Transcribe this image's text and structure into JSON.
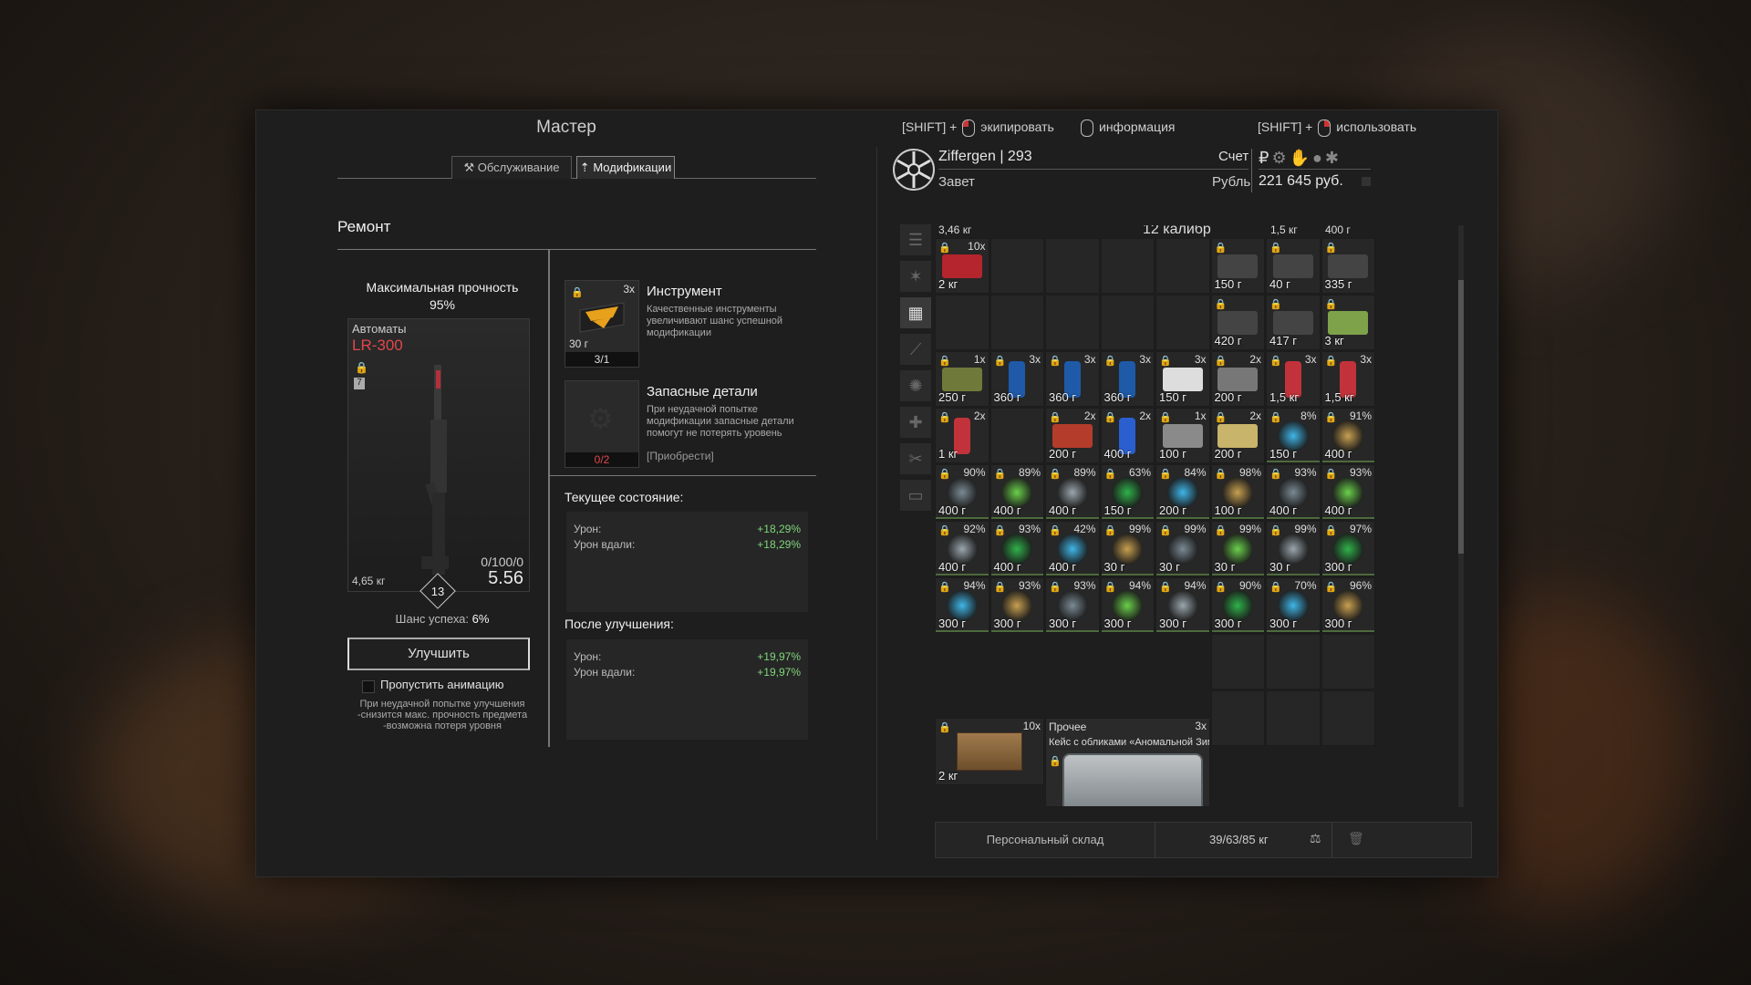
{
  "master": {
    "title": "Мастер",
    "tabs": [
      {
        "label": "Обслуживание",
        "icon": "wrench-icon"
      },
      {
        "label": "Модификации",
        "icon": "upgrade-icon"
      }
    ],
    "section_title": "Ремонт",
    "durability_label": "Максимальная прочность",
    "durability_value": "95%",
    "weapon": {
      "category": "Автоматы",
      "name": "LR-300",
      "rank_badge": "7",
      "weight": "4,65 кг",
      "level": "13",
      "ammo_counter": "0/100/0",
      "caliber": "5.56"
    },
    "success_chance_label": "Шанс успеха:",
    "success_chance_value": "6%",
    "upgrade_button": "Улучшить",
    "skip_animation": "Пропустить анимацию",
    "failure_note": [
      "При неудачной попытке улучшения",
      "-снизится макс. прочность предмета",
      "-возможна потеря уровня"
    ],
    "tool": {
      "title": "Инструмент",
      "count": "3x",
      "weight": "30 г",
      "usage": "3/1",
      "desc": [
        "Качественные инструменты",
        "увеличивают шанс успешной",
        "модификации"
      ]
    },
    "spare": {
      "title": "Запасные детали",
      "usage": "0/2",
      "desc": [
        "При неудачной попытке",
        "модификации запасные детали",
        "помогут не потерять уровень"
      ],
      "buy": "[Приобрести]"
    },
    "current_state": {
      "title": "Текущее состояние:",
      "rows": [
        {
          "label": "Урон:",
          "value": "+18,29%"
        },
        {
          "label": "Урон вдали:",
          "value": "+18,29%"
        }
      ]
    },
    "after_upgrade": {
      "title": "После улучшения:",
      "rows": [
        {
          "label": "Урон:",
          "value": "+19,97%"
        },
        {
          "label": "Урон вдали:",
          "value": "+19,97%"
        }
      ]
    }
  },
  "inventory": {
    "hints": [
      {
        "key": "[SHIFT] +",
        "mouse": "left",
        "action": "экипировать"
      },
      {
        "key": "",
        "mouse": "none",
        "action": "информация"
      },
      {
        "key": "[SHIFT] +",
        "mouse": "right",
        "action": "использовать"
      }
    ],
    "player": {
      "name": "Ziffergen",
      "separator": "|",
      "level": "293",
      "faction": "Завет"
    },
    "account_label": "Счет",
    "currency_label": "Рубль",
    "money": "221 645 руб.",
    "currency_icons": [
      "ruble-icon",
      "gear-icon",
      "hand-icon",
      "coin-icon",
      "badge-icon"
    ],
    "side_tabs": [
      "list-icon",
      "star-icon",
      "grid-icon",
      "rifle-icon",
      "artifact-icon",
      "medkit-icon",
      "tools-icon",
      "box-icon"
    ],
    "top_partial": [
      "3,46 кг",
      "12 калибр",
      "1,5 кг",
      "400 г"
    ],
    "items": [
      {
        "count": "10x",
        "weight": "2 кг",
        "icon": "toolkit-icon"
      },
      {
        "count": "",
        "weight": "150 г",
        "icon": "scope-icon"
      },
      {
        "count": "",
        "weight": "40 г",
        "icon": "scope-icon"
      },
      {
        "count": "",
        "weight": "335 г",
        "icon": "scope-icon"
      },
      {
        "count": "",
        "weight": "420 г",
        "icon": "scope-icon"
      },
      {
        "count": "",
        "weight": "417 г",
        "icon": "scope-icon"
      },
      {
        "count": "",
        "weight": "3 кг",
        "icon": "device-icon"
      },
      {
        "count": "1x",
        "weight": "250 г",
        "icon": "canned-food-icon"
      },
      {
        "count": "3x",
        "weight": "360 г",
        "icon": "energy-drink-icon"
      },
      {
        "count": "3x",
        "weight": "360 г",
        "icon": "energy-drink-icon"
      },
      {
        "count": "3x",
        "weight": "360 г",
        "icon": "energy-drink-icon"
      },
      {
        "count": "3x",
        "weight": "150 г",
        "icon": "pills-icon"
      },
      {
        "count": "2x",
        "weight": "200 г",
        "icon": "syringe-icon"
      },
      {
        "count": "3x",
        "weight": "1,5 кг",
        "icon": "bottle-icon"
      },
      {
        "count": "3x",
        "weight": "1,5 кг",
        "icon": "bottle-icon"
      },
      {
        "count": "2x",
        "weight": "1 кг",
        "icon": "bottle-icon"
      },
      {
        "count": "2x",
        "weight": "200 г",
        "icon": "injector-icon"
      },
      {
        "count": "2x",
        "weight": "400 г",
        "icon": "vial-icon"
      },
      {
        "count": "1x",
        "weight": "100 г",
        "icon": "dogtag-icon"
      },
      {
        "count": "2x",
        "weight": "200 г",
        "icon": "herb-icon"
      },
      {
        "count": "8%",
        "weight": "150 г",
        "icon": "artifact-icon"
      },
      {
        "count": "91%",
        "weight": "400 г",
        "icon": "artifact-icon"
      },
      {
        "count": "90%",
        "weight": "400 г",
        "icon": "artifact-icon"
      },
      {
        "count": "89%",
        "weight": "400 г",
        "icon": "artifact-icon"
      },
      {
        "count": "89%",
        "weight": "400 г",
        "icon": "artifact-icon"
      },
      {
        "count": "63%",
        "weight": "150 г",
        "icon": "artifact-icon"
      },
      {
        "count": "84%",
        "weight": "200 г",
        "icon": "artifact-icon"
      },
      {
        "count": "98%",
        "weight": "100 г",
        "icon": "artifact-icon"
      },
      {
        "count": "93%",
        "weight": "400 г",
        "icon": "artifact-icon"
      },
      {
        "count": "93%",
        "weight": "400 г",
        "icon": "artifact-icon"
      },
      {
        "count": "92%",
        "weight": "400 г",
        "icon": "artifact-icon"
      },
      {
        "count": "93%",
        "weight": "400 г",
        "icon": "artifact-icon"
      },
      {
        "count": "42%",
        "weight": "400 г",
        "icon": "artifact-icon"
      },
      {
        "count": "99%",
        "weight": "30 г",
        "icon": "artifact-icon"
      },
      {
        "count": "99%",
        "weight": "30 г",
        "icon": "artifact-icon"
      },
      {
        "count": "99%",
        "weight": "30 г",
        "icon": "artifact-icon"
      },
      {
        "count": "99%",
        "weight": "30 г",
        "icon": "artifact-icon"
      },
      {
        "count": "97%",
        "weight": "300 г",
        "icon": "artifact-icon"
      },
      {
        "count": "94%",
        "weight": "300 г",
        "icon": "artifact-icon"
      },
      {
        "count": "93%",
        "weight": "300 г",
        "icon": "artifact-icon"
      },
      {
        "count": "93%",
        "weight": "300 г",
        "icon": "artifact-icon"
      },
      {
        "count": "94%",
        "weight": "300 г",
        "icon": "artifact-icon"
      },
      {
        "count": "94%",
        "weight": "300 г",
        "icon": "artifact-icon"
      },
      {
        "count": "90%",
        "weight": "300 г",
        "icon": "artifact-icon"
      },
      {
        "count": "70%",
        "weight": "300 г",
        "icon": "artifact-icon"
      },
      {
        "count": "96%",
        "weight": "300 г",
        "icon": "artifact-icon"
      }
    ],
    "crate": {
      "count": "10x",
      "weight": "2 кг",
      "icon": "crate-icon"
    },
    "case": {
      "category": "Прочее",
      "count": "3x",
      "name": "Кейс с обликами «Аномальной Зимы..",
      "icon": "case-icon"
    },
    "storage_label": "Персональный склад",
    "weight_status": "39/63/85 кг",
    "colors": {
      "accent_red": "#e0474c",
      "positive_green": "#7fd67a",
      "artifact_underline": "#4d6a3d"
    }
  }
}
